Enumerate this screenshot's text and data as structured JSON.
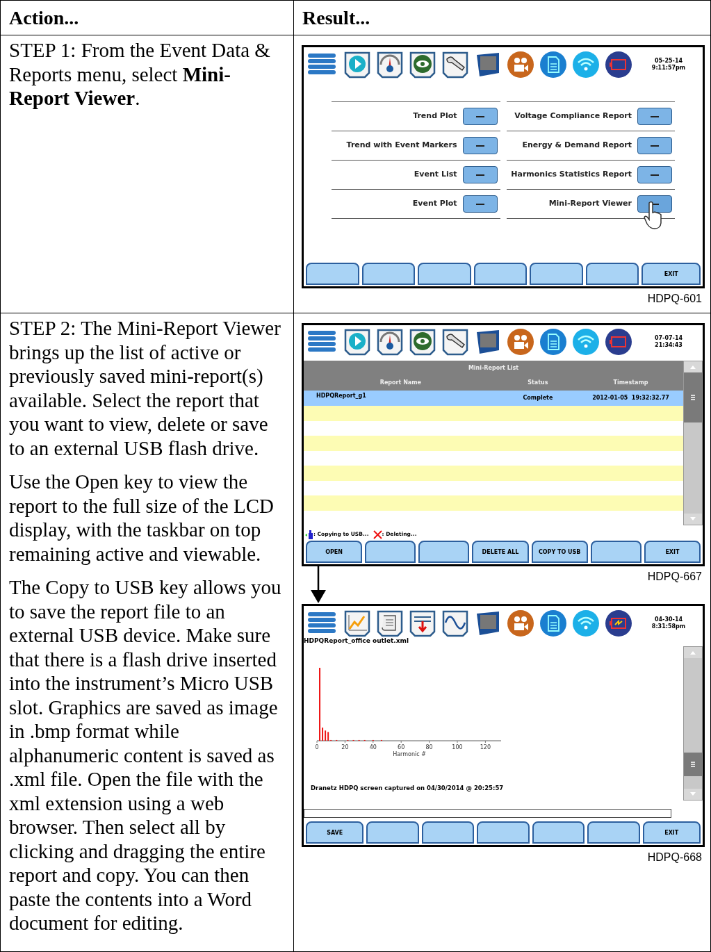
{
  "headers": [
    "Action...",
    "Result..."
  ],
  "rows": [
    {
      "paragraphs": [
        "STEP 1: From the Event Data & Reports menu, select **Mini-Report Viewer**."
      ],
      "screens": [
        {
          "kind": "menu",
          "date": "05-25-14",
          "time": "9:11:57pm",
          "menu_columns": [
            [
              {
                "label": "Trend Plot",
                "tapped": false
              },
              {
                "label": "Trend with Event Markers",
                "tapped": false
              },
              {
                "label": "Event List",
                "tapped": false
              },
              {
                "label": "Event Plot",
                "tapped": false
              }
            ],
            [
              {
                "label": "Voltage Compliance Report",
                "tapped": false
              },
              {
                "label": "Energy & Demand Report",
                "tapped": false
              },
              {
                "label": "Harmonics Statistics Report",
                "tapped": false
              },
              {
                "label": "Mini-Report Viewer",
                "tapped": true
              }
            ]
          ],
          "softkeys": [
            {
              "kind": "blank"
            },
            {
              "kind": "blank"
            },
            {
              "kind": "blank"
            },
            {
              "kind": "blank"
            },
            {
              "kind": "blank"
            },
            {
              "kind": "blank"
            },
            {
              "kind": "labeled",
              "label": "EXIT"
            }
          ],
          "caption": "HDPQ-601",
          "arrow_below": false
        }
      ]
    },
    {
      "paragraphs": [
        "STEP 2: The Mini-Report Viewer brings up the list of active or previously saved mini-report(s) available. Select the report that you want to view, delete or save to an external USB flash drive.",
        "Use the Open key to view the report to the full size of the LCD display, with the taskbar on top remaining active and viewable.",
        "The Copy to USB key allows you to save the report file to an external USB device. Make sure that there is a flash drive inserted into the instrument’s Micro USB slot. Graphics are saved as image in .bmp format while alphanumeric content is saved as .xml file. Open the file with the xml extension using a web browser. Then select all by clicking and dragging the entire report and copy. You can then paste the contents into a Word document for editing."
      ],
      "screens": [
        {
          "kind": "list",
          "date": "07-07-14",
          "time": "21:34:43",
          "list_title": "Mini-Report List",
          "columns": [
            "Report Name",
            "Status",
            "Timestamp"
          ],
          "rows": [
            {
              "cells": [
                "HDPQReport_g1",
                "Complete",
                "2012-01-05  19:32:32.77"
              ],
              "selected": true
            }
          ],
          "legend": [
            ": Copying to USB...",
            ": Deleting..."
          ],
          "softkeys": [
            {
              "kind": "labeled",
              "label": "OPEN"
            },
            {
              "kind": "blank"
            },
            {
              "kind": "blank"
            },
            {
              "kind": "labeled",
              "label": "DELETE ALL"
            },
            {
              "kind": "labeled",
              "label": "COPY TO USB"
            },
            {
              "kind": "blank"
            },
            {
              "kind": "labeled",
              "label": "EXIT"
            }
          ],
          "caption": "HDPQ-667",
          "arrow_below": true
        },
        {
          "kind": "viewer",
          "date": "04-30-14",
          "time": "8:31:58pm",
          "file_name": "HDPQReport_office outlet.xml",
          "chart": {
            "xlabel": "Harmonic #",
            "xticks": [
              "0",
              "20",
              "40",
              "60",
              "80",
              "100",
              "120"
            ]
          },
          "note": "Dranetz HDPQ screen captured on 04/30/2014 @ 20:25:57",
          "softkeys": [
            {
              "kind": "labeled",
              "label": "SAVE"
            },
            {
              "kind": "blank"
            },
            {
              "kind": "blank"
            },
            {
              "kind": "blank"
            },
            {
              "kind": "blank"
            },
            {
              "kind": "blank"
            },
            {
              "kind": "labeled",
              "label": "EXIT"
            }
          ],
          "caption": "HDPQ-668",
          "arrow_below": false
        }
      ]
    }
  ]
}
